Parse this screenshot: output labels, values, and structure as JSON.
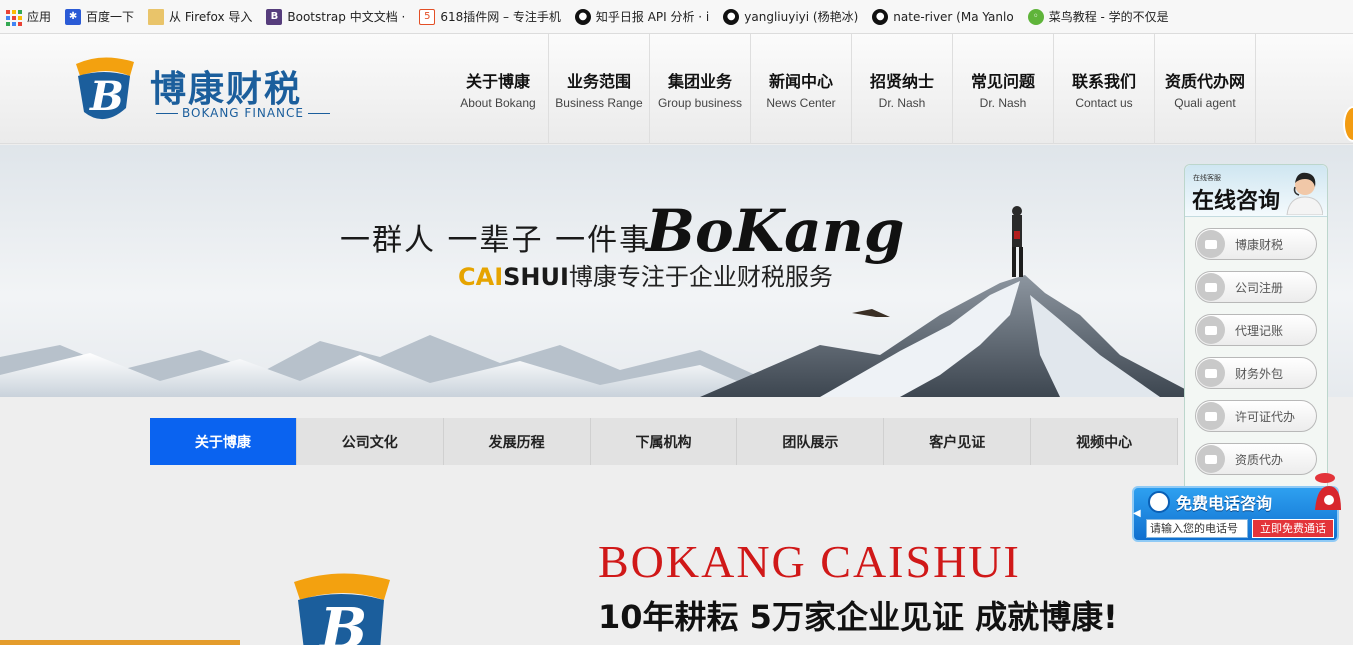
{
  "bookmarks": [
    {
      "label": "应用",
      "icon": "apps-icon"
    },
    {
      "label": "百度一下",
      "icon": "baidu-paw-icon"
    },
    {
      "label": "从 Firefox 导入",
      "icon": "folder-icon"
    },
    {
      "label": "Bootstrap 中文文档 ·",
      "icon": "bootstrap-icon"
    },
    {
      "label": "618插件网 – 专注手机",
      "icon": "html5-icon"
    },
    {
      "label": "知乎日报 API 分析 · i",
      "icon": "github-icon"
    },
    {
      "label": "yangliuyiyi (杨艳冰)",
      "icon": "github-icon"
    },
    {
      "label": "nate-river (Ma Yanlo",
      "icon": "github-icon"
    },
    {
      "label": "菜鸟教程 - 学的不仅是",
      "icon": "runoob-icon"
    }
  ],
  "logo": {
    "name": "博康财税",
    "sub": "BOKANG FINANCE"
  },
  "nav": [
    {
      "cn": "关于博康",
      "en": "About Bokang"
    },
    {
      "cn": "业务范围",
      "en": "Business Range"
    },
    {
      "cn": "集团业务",
      "en": "Group business"
    },
    {
      "cn": "新闻中心",
      "en": "News Center"
    },
    {
      "cn": "招贤纳士",
      "en": "Dr. Nash"
    },
    {
      "cn": "常见问题",
      "en": "Dr. Nash"
    },
    {
      "cn": "联系我们",
      "en": "Contact us"
    },
    {
      "cn": "资质代办网",
      "en": "Quali agent"
    }
  ],
  "banner": {
    "slogan": "一群人 一辈子 一件事",
    "brand": "BoKang",
    "caishui_yellow": "CAI",
    "caishui_dark": "SHUI",
    "caishui_rest": "博康专注于企业财税服务"
  },
  "tabs": [
    {
      "label": "关于博康",
      "active": true
    },
    {
      "label": "公司文化",
      "active": false
    },
    {
      "label": "发展历程",
      "active": false
    },
    {
      "label": "下属机构",
      "active": false
    },
    {
      "label": "团队展示",
      "active": false
    },
    {
      "label": "客户见证",
      "active": false
    },
    {
      "label": "视频中心",
      "active": false
    }
  ],
  "content": {
    "title": "BOKANG CAISHUI",
    "subtitle": "10年耕耘 5万家企业见证 成就博康!"
  },
  "consult": {
    "small_label": "在线客服",
    "title": "在线咨询",
    "items": [
      "博康财税",
      "公司注册",
      "代理记账",
      "财务外包",
      "许可证代办",
      "资质代办"
    ]
  },
  "phone": {
    "title": "免费电话咨询",
    "input_placeholder": "请输入您的电话号",
    "button": "立即免费通话"
  },
  "colors": {
    "brand_blue": "#1b5e9c",
    "tab_active": "#0a63f0",
    "title_red": "#d01818",
    "accent_orange": "#e6a400"
  }
}
